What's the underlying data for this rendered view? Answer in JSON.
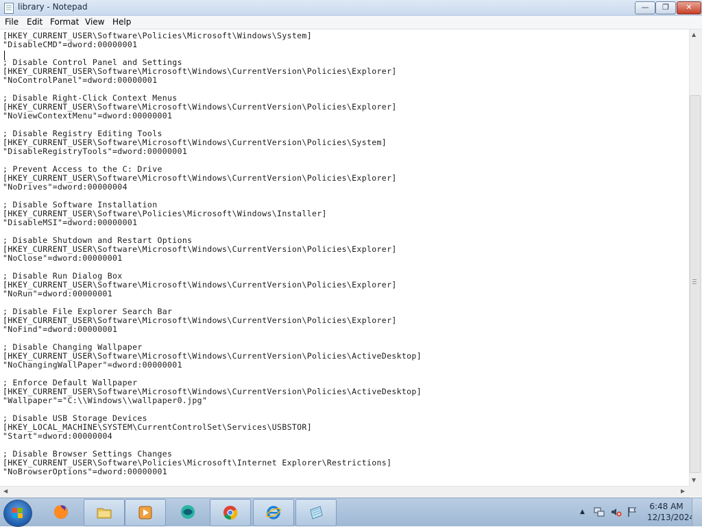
{
  "window": {
    "title": "library - Notepad",
    "minimize_glyph": "—",
    "maximize_glyph": "❐",
    "close_glyph": "✕"
  },
  "menu": {
    "items": [
      "File",
      "Edit",
      "Format",
      "View",
      "Help"
    ]
  },
  "editor": {
    "lines": [
      "[HKEY_CURRENT_USER\\Software\\Policies\\Microsoft\\Windows\\System]",
      "\"DisableCMD\"=dword:00000001",
      "",
      "; Disable Control Panel and Settings",
      "[HKEY_CURRENT_USER\\Software\\Microsoft\\Windows\\CurrentVersion\\Policies\\Explorer]",
      "\"NoControlPanel\"=dword:00000001",
      "",
      "; Disable Right-Click Context Menus",
      "[HKEY_CURRENT_USER\\Software\\Microsoft\\Windows\\CurrentVersion\\Policies\\Explorer]",
      "\"NoViewContextMenu\"=dword:00000001",
      "",
      "; Disable Registry Editing Tools",
      "[HKEY_CURRENT_USER\\Software\\Microsoft\\Windows\\CurrentVersion\\Policies\\System]",
      "\"DisableRegistryTools\"=dword:00000001",
      "",
      "; Prevent Access to the C: Drive",
      "[HKEY_CURRENT_USER\\Software\\Microsoft\\Windows\\CurrentVersion\\Policies\\Explorer]",
      "\"NoDrives\"=dword:00000004",
      "",
      "; Disable Software Installation",
      "[HKEY_CURRENT_USER\\Software\\Policies\\Microsoft\\Windows\\Installer]",
      "\"DisableMSI\"=dword:00000001",
      "",
      "; Disable Shutdown and Restart Options",
      "[HKEY_CURRENT_USER\\Software\\Microsoft\\Windows\\CurrentVersion\\Policies\\Explorer]",
      "\"NoClose\"=dword:00000001",
      "",
      "; Disable Run Dialog Box",
      "[HKEY_CURRENT_USER\\Software\\Microsoft\\Windows\\CurrentVersion\\Policies\\Explorer]",
      "\"NoRun\"=dword:00000001",
      "",
      "; Disable File Explorer Search Bar",
      "[HKEY_CURRENT_USER\\Software\\Microsoft\\Windows\\CurrentVersion\\Policies\\Explorer]",
      "\"NoFind\"=dword:00000001",
      "",
      "; Disable Changing Wallpaper",
      "[HKEY_CURRENT_USER\\Software\\Microsoft\\Windows\\CurrentVersion\\Policies\\ActiveDesktop]",
      "\"NoChangingWallPaper\"=dword:00000001",
      "",
      "; Enforce Default Wallpaper",
      "[HKEY_CURRENT_USER\\Software\\Microsoft\\Windows\\CurrentVersion\\Policies\\ActiveDesktop]",
      "\"Wallpaper\"=\"C:\\\\Windows\\\\wallpaper0.jpg\"",
      "",
      "; Disable USB Storage Devices",
      "[HKEY_LOCAL_MACHINE\\SYSTEM\\CurrentControlSet\\Services\\USBSTOR]",
      "\"Start\"=dword:00000004",
      "",
      "; Disable Browser Settings Changes",
      "[HKEY_CURRENT_USER\\Software\\Policies\\Microsoft\\Internet Explorer\\Restrictions]",
      "\"NoBrowserOptions\"=dword:00000001"
    ]
  },
  "scrollbars": {
    "up_arrow": "▲",
    "down_arrow": "▼",
    "left_arrow": "◀",
    "right_arrow": "▶"
  },
  "taskbar": {
    "apps": [
      {
        "name": "firefox",
        "icon": "firefox-icon"
      },
      {
        "name": "file-explorer",
        "icon": "folder-icon"
      },
      {
        "name": "media-player",
        "icon": "media-player-icon"
      },
      {
        "name": "app-4",
        "icon": "globe-app-icon"
      },
      {
        "name": "chrome",
        "icon": "chrome-icon"
      },
      {
        "name": "internet-explorer",
        "icon": "ie-icon"
      },
      {
        "name": "notepad",
        "icon": "notepad-icon"
      }
    ],
    "tray": {
      "show_hidden_glyph": "▲",
      "time": "6:48 AM",
      "date": "12/13/2024"
    }
  },
  "colors": {
    "titlebar": "#c9d9ee",
    "taskbar": "#9fb8d4",
    "close_button": "#c7402a",
    "text": "#1a1a1a"
  }
}
